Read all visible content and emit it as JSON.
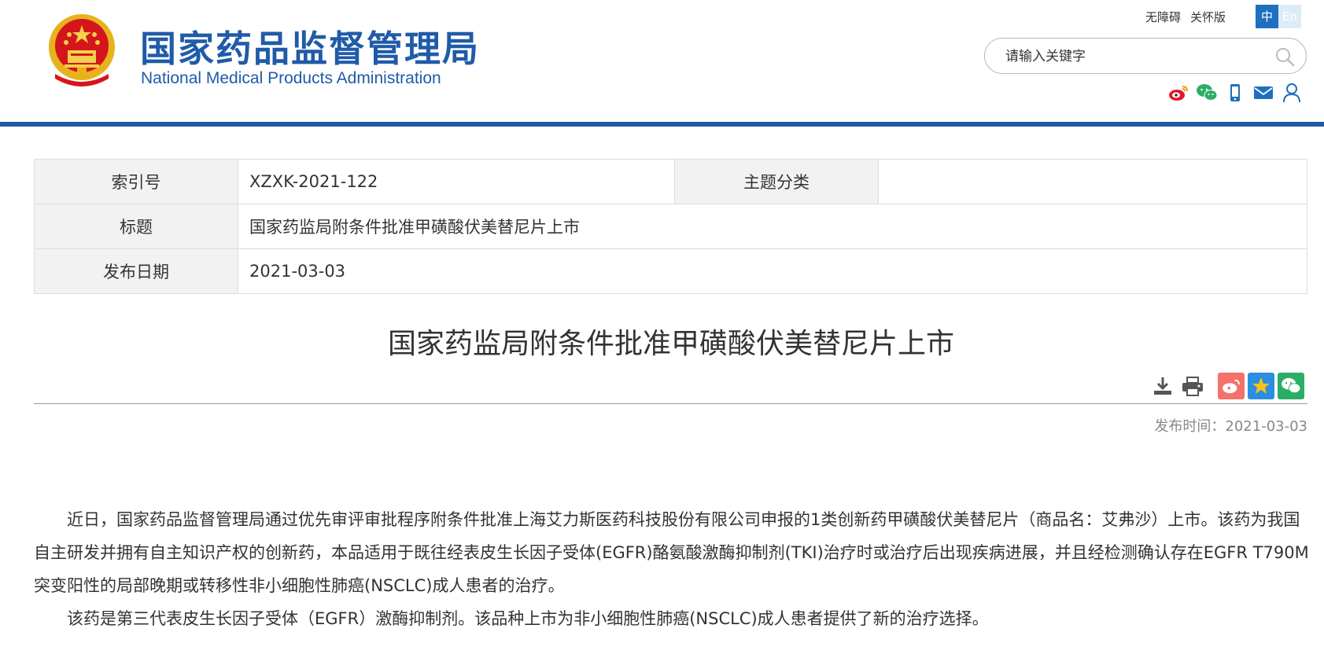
{
  "header": {
    "title_cn": "国家药品监督管理局",
    "title_en": "National Medical Products Administration",
    "util_links": [
      "无障碍",
      "关怀版"
    ],
    "lang": {
      "zh": "中",
      "en": "En"
    },
    "search_placeholder": "请输入关键字",
    "social_icons": [
      "weibo-icon",
      "wechat-icon",
      "mobile-icon",
      "mail-icon",
      "user-icon"
    ],
    "brand_color": "#1f5ba8"
  },
  "info": {
    "index_label": "索引号",
    "index_value": "XZXK-2021-122",
    "topic_label": "主题分类",
    "topic_value": "",
    "title_label": "标题",
    "title_value": "国家药监局附条件批准甲磺酸伏美替尼片上市",
    "date_label": "发布日期",
    "date_value": "2021-03-03"
  },
  "article": {
    "title": "国家药监局附条件批准甲磺酸伏美替尼片上市",
    "tool_icons": [
      "download-icon",
      "print-icon",
      "weibo-share-icon",
      "favorite-icon",
      "wechat-share-icon"
    ],
    "pubtime_label": "发布时间：",
    "pubtime_value": "2021-03-03",
    "paragraph1": "近日，国家药品监督管理局通过优先审评审批程序附条件批准上海艾力斯医药科技股份有限公司申报的1类创新药甲磺酸伏美替尼片（商品名：艾弗沙）上市。该药为我国自主研发并拥有自主知识产权的创新药，本品适用于既往经表皮生长因子受体(EGFR)酪氨酸激酶抑制剂(TKI)治疗时或治疗后出现疾病进展，并且经检测确认存在EGFR T790M突变阳性的局部晚期或转移性非小细胞性肺癌(NSCLC)成人患者的治疗。",
    "paragraph2": "该药是第三代表皮生长因子受体（EGFR）激酶抑制剂。该品种上市为非小细胞性肺癌(NSCLC)成人患者提供了新的治疗选择。"
  }
}
